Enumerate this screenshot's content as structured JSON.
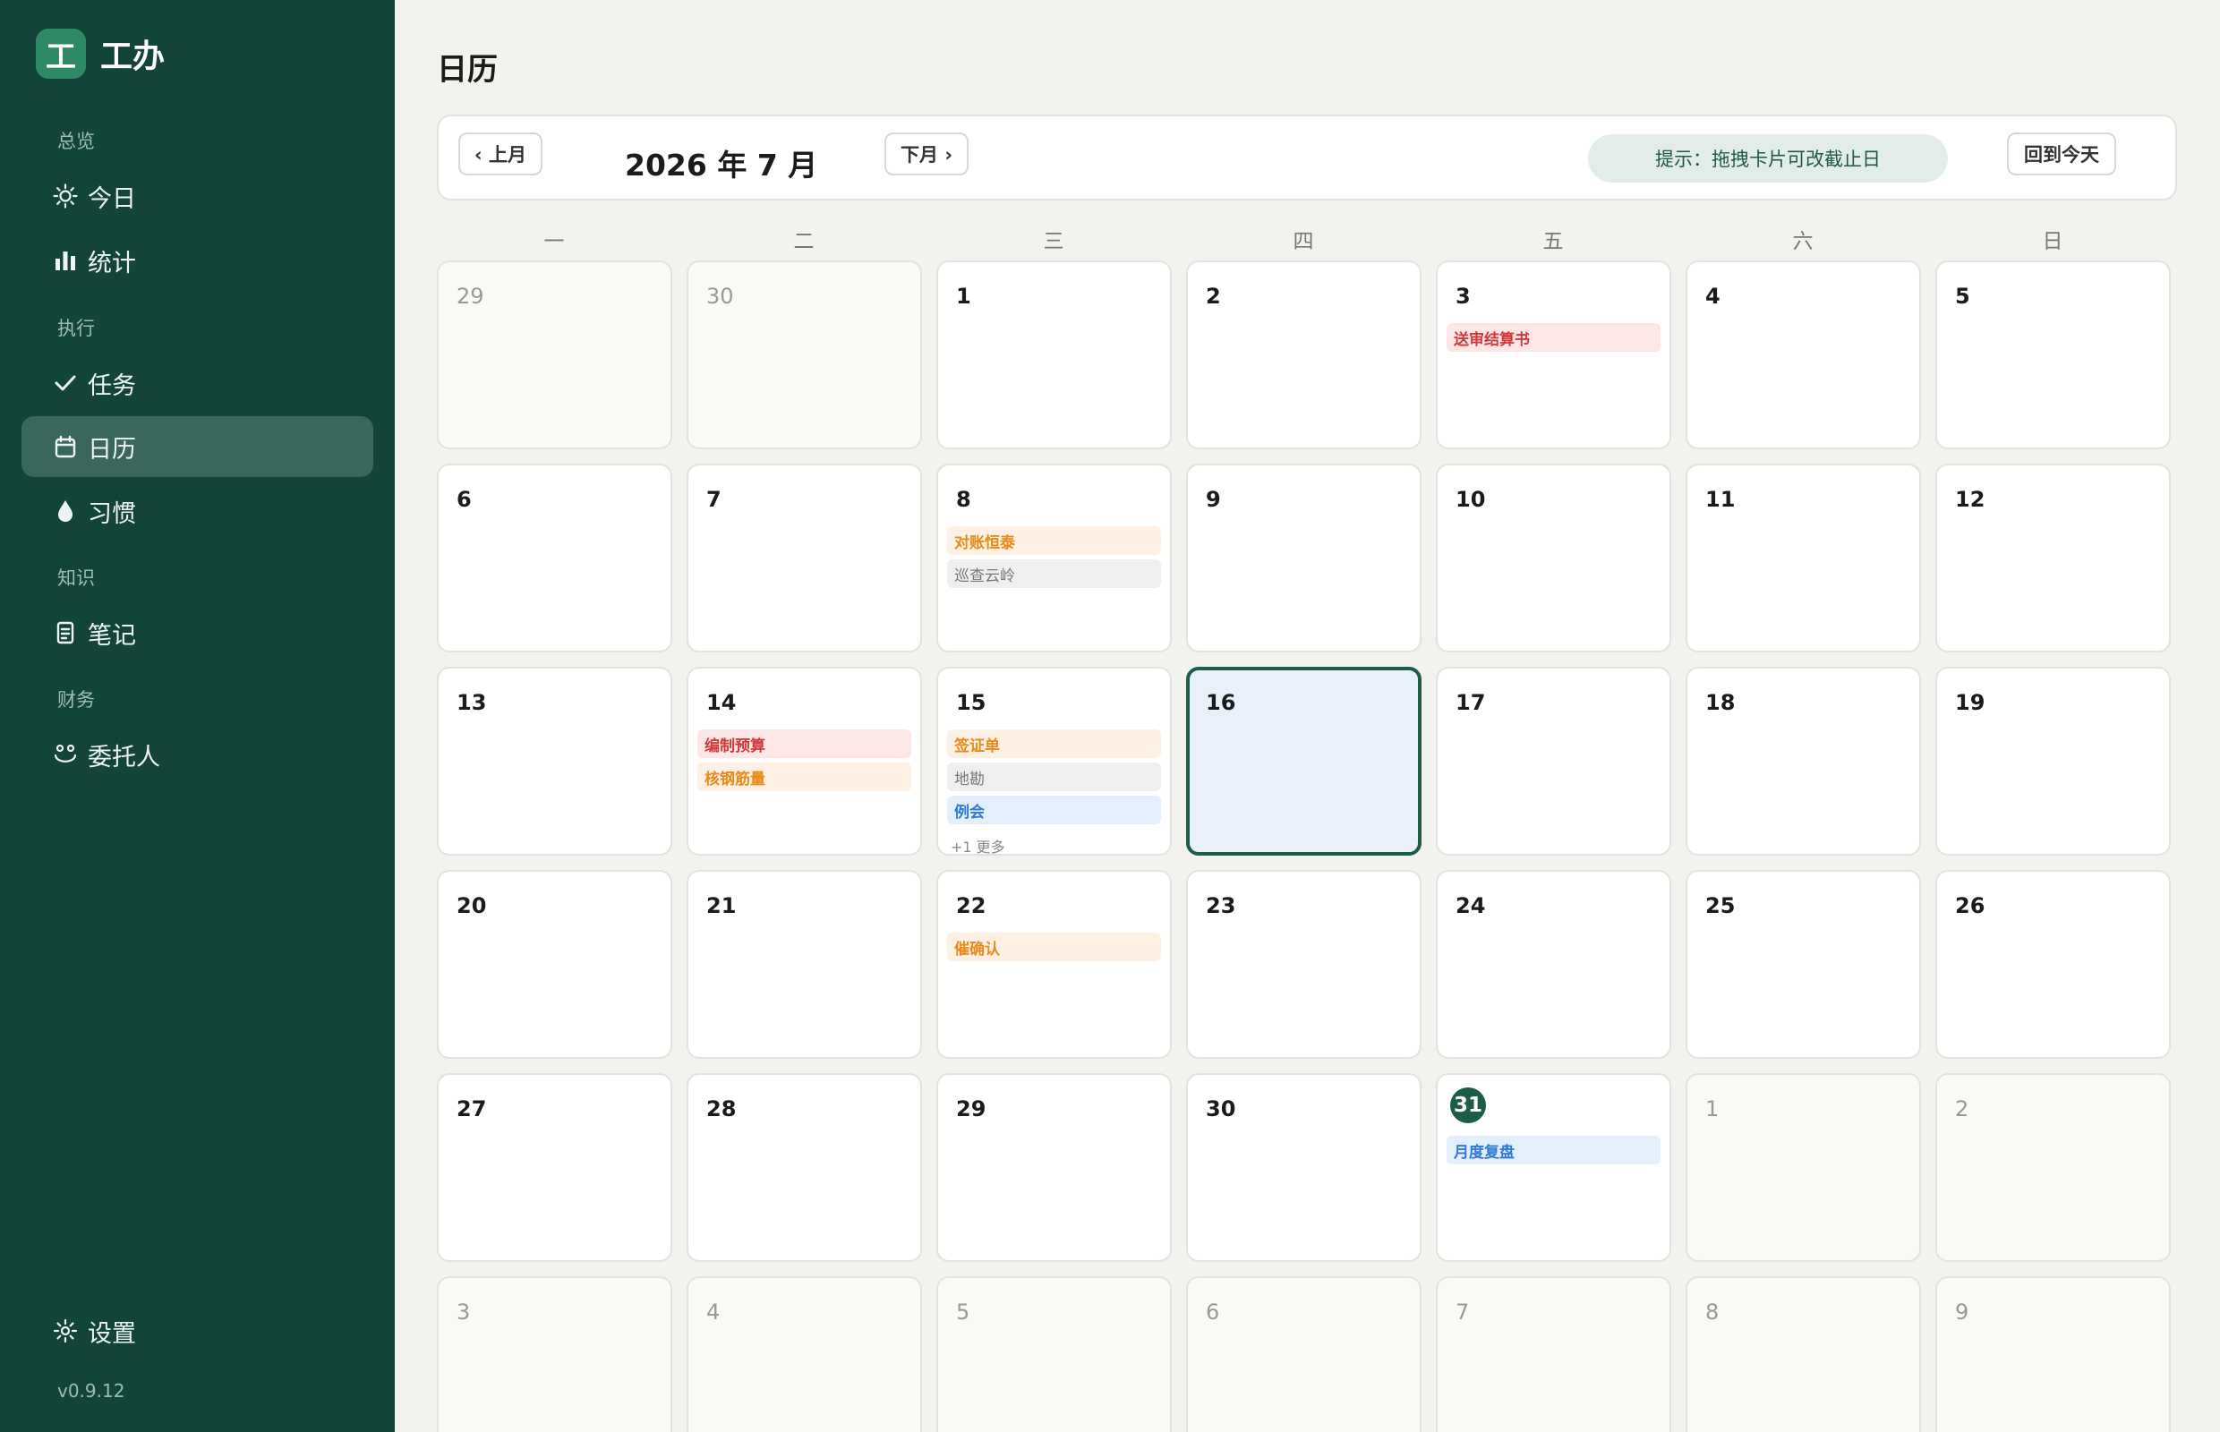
{
  "app": {
    "logo_char": "工",
    "name": "工办",
    "version": "v0.9.12"
  },
  "sidebar": {
    "sections": [
      "总览",
      "执行",
      "知识",
      "财务"
    ],
    "items": [
      {
        "label": "今日",
        "icon": "sun-icon"
      },
      {
        "label": "统计",
        "icon": "bar-chart-icon"
      },
      {
        "label": "任务",
        "icon": "check-icon"
      },
      {
        "label": "日历",
        "icon": "calendar-icon",
        "active": true
      },
      {
        "label": "习惯",
        "icon": "drop-icon"
      },
      {
        "label": "笔记",
        "icon": "note-icon"
      },
      {
        "label": "委托人",
        "icon": "clients-icon"
      }
    ],
    "settings_label": "设置"
  },
  "page_title": "日历",
  "toolbar": {
    "prev_label": "‹ 上月",
    "next_label": "下月 ›",
    "month_title": "2026 年 7 月",
    "hint": "提示：拖拽卡片可改截止日",
    "today_label": "回到今天"
  },
  "weekdays": [
    "一",
    "二",
    "三",
    "四",
    "五",
    "六",
    "日"
  ],
  "colors": {
    "sidebar": "#13443a",
    "accent": "#1c5c48",
    "red": "#d13a3a",
    "orange": "#e88a1a",
    "blue": "#2f7ad6"
  },
  "weeks": [
    [
      {
        "n": "29",
        "other": true
      },
      {
        "n": "30",
        "other": true
      },
      {
        "n": "1"
      },
      {
        "n": "2"
      },
      {
        "n": "3",
        "events": [
          {
            "t": "送审结算书",
            "c": "red"
          }
        ]
      },
      {
        "n": "4"
      },
      {
        "n": "5"
      }
    ],
    [
      {
        "n": "6"
      },
      {
        "n": "7"
      },
      {
        "n": "8",
        "events": [
          {
            "t": "对账恒泰",
            "c": "orange"
          },
          {
            "t": "巡查云岭",
            "c": "gray"
          }
        ]
      },
      {
        "n": "9"
      },
      {
        "n": "10"
      },
      {
        "n": "11"
      },
      {
        "n": "12"
      }
    ],
    [
      {
        "n": "13"
      },
      {
        "n": "14",
        "events": [
          {
            "t": "编制预算",
            "c": "red"
          },
          {
            "t": "核钢筋量",
            "c": "orange"
          }
        ]
      },
      {
        "n": "15",
        "events": [
          {
            "t": "签证单",
            "c": "orange"
          },
          {
            "t": "地勘",
            "c": "gray"
          },
          {
            "t": "例会",
            "c": "blue"
          }
        ],
        "more": "+1 更多"
      },
      {
        "n": "16",
        "selected": true
      },
      {
        "n": "17"
      },
      {
        "n": "18"
      },
      {
        "n": "19"
      }
    ],
    [
      {
        "n": "20"
      },
      {
        "n": "21"
      },
      {
        "n": "22",
        "events": [
          {
            "t": "催确认",
            "c": "orange"
          }
        ]
      },
      {
        "n": "23"
      },
      {
        "n": "24"
      },
      {
        "n": "25"
      },
      {
        "n": "26"
      }
    ],
    [
      {
        "n": "27"
      },
      {
        "n": "28"
      },
      {
        "n": "29"
      },
      {
        "n": "30"
      },
      {
        "n": "31",
        "today": true,
        "events": [
          {
            "t": "月度复盘",
            "c": "blue"
          }
        ]
      },
      {
        "n": "1",
        "other": true
      },
      {
        "n": "2",
        "other": true
      }
    ],
    [
      {
        "n": "3",
        "other": true
      },
      {
        "n": "4",
        "other": true
      },
      {
        "n": "5",
        "other": true
      },
      {
        "n": "6",
        "other": true
      },
      {
        "n": "7",
        "other": true
      },
      {
        "n": "8",
        "other": true
      },
      {
        "n": "9",
        "other": true
      }
    ]
  ]
}
